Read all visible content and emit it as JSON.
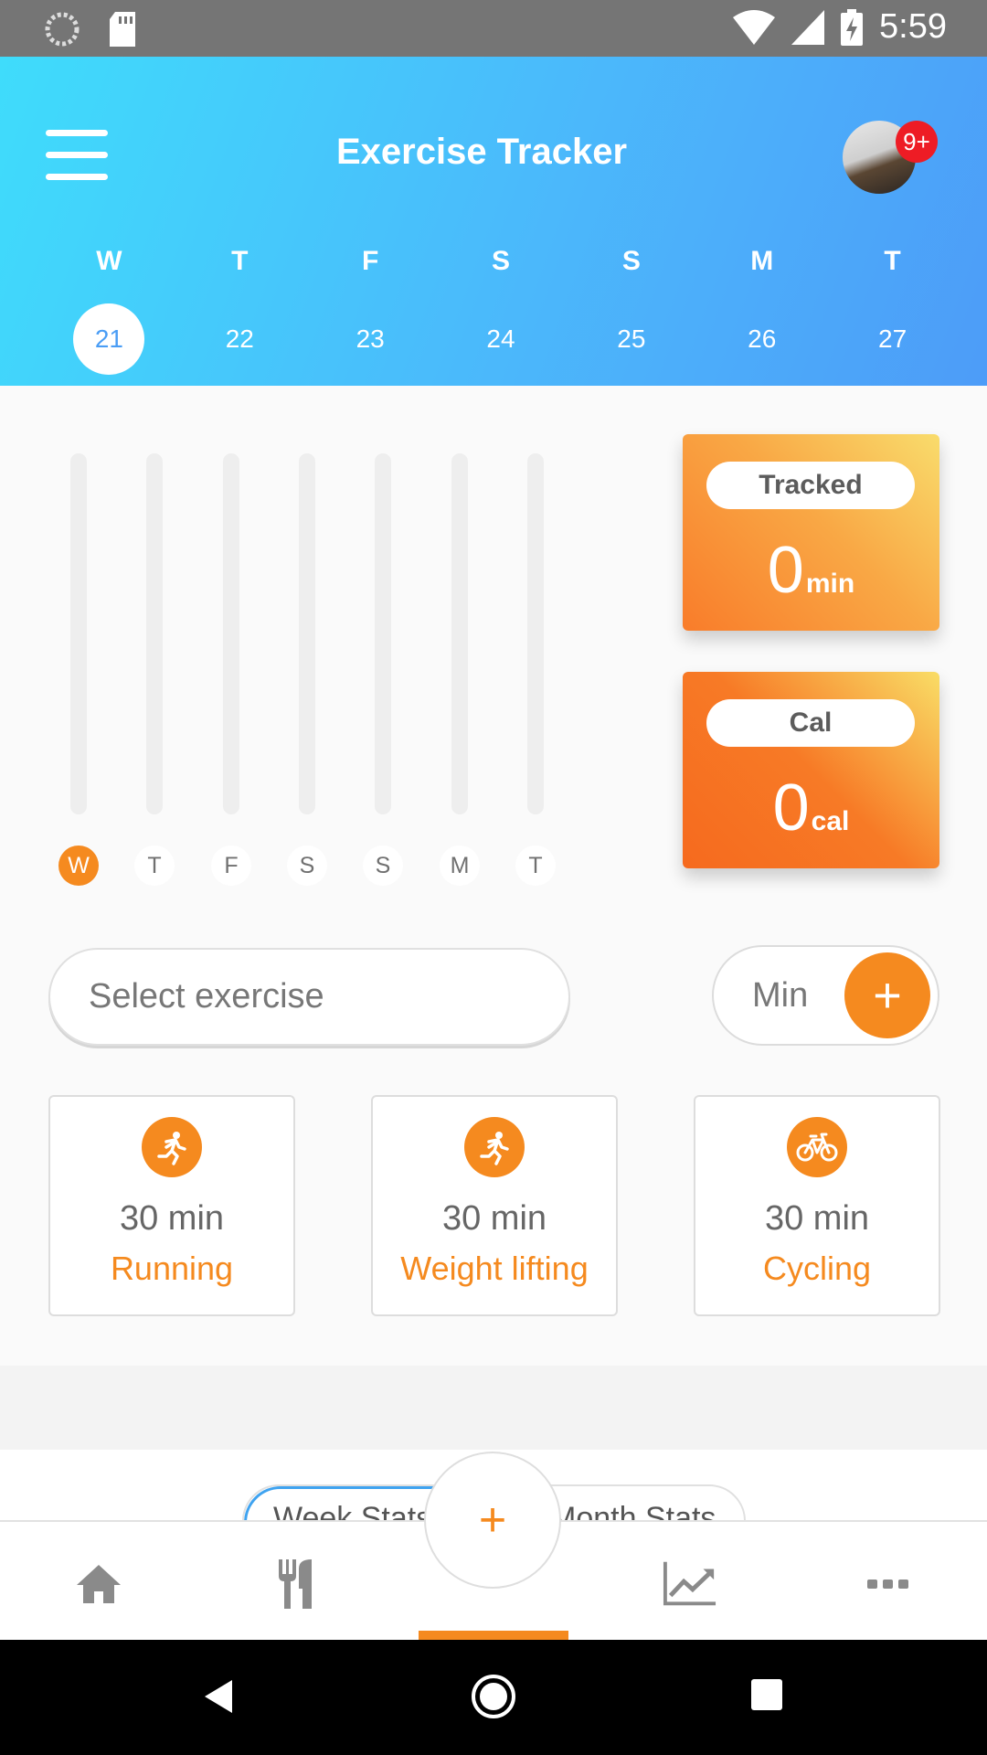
{
  "status_bar": {
    "time": "5:59"
  },
  "header": {
    "title": "Exercise Tracker",
    "badge": "9+"
  },
  "week": [
    {
      "letter": "W",
      "date": "21",
      "selected": true
    },
    {
      "letter": "T",
      "date": "22",
      "selected": false
    },
    {
      "letter": "F",
      "date": "23",
      "selected": false
    },
    {
      "letter": "S",
      "date": "24",
      "selected": false
    },
    {
      "letter": "S",
      "date": "25",
      "selected": false
    },
    {
      "letter": "M",
      "date": "26",
      "selected": false
    },
    {
      "letter": "T",
      "date": "27",
      "selected": false
    }
  ],
  "bar_chart": {
    "labels": [
      "W",
      "T",
      "F",
      "S",
      "S",
      "M",
      "T"
    ],
    "values": [
      0,
      0,
      0,
      0,
      0,
      0,
      0
    ]
  },
  "stats": {
    "tracked": {
      "label": "Tracked",
      "value": "0",
      "unit": "min"
    },
    "cal": {
      "label": "Cal",
      "value": "0",
      "unit": "cal"
    }
  },
  "input": {
    "select_placeholder": "Select exercise",
    "min_label": "Min",
    "add_symbol": "+"
  },
  "exercises": [
    {
      "duration": "30 min",
      "name": "Running",
      "icon": "running-icon"
    },
    {
      "duration": "30 min",
      "name": "Weight lifting",
      "icon": "running-icon"
    },
    {
      "duration": "30 min",
      "name": "Cycling",
      "icon": "bicycle-icon"
    }
  ],
  "tabs": {
    "week": "Week Stats",
    "month": "Month Stats"
  },
  "fab": {
    "symbol": "+"
  },
  "nav": [
    "home-icon",
    "food-icon",
    "add",
    "chart-icon",
    "more-icon"
  ],
  "colors": {
    "accent": "#f58a1f",
    "header_start": "#3fdcfb",
    "header_end": "#4d9cf8",
    "badge": "#ee1c25"
  }
}
